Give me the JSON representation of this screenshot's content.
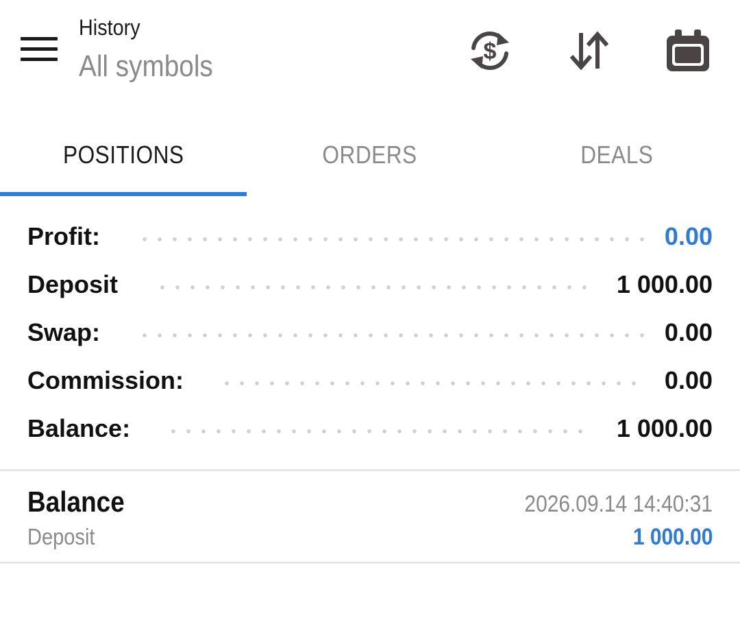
{
  "header": {
    "title": "History",
    "subtitle": "All symbols",
    "icons": [
      "menu-icon",
      "currency-exchange-icon",
      "sort-arrows-icon",
      "calendar-icon"
    ]
  },
  "tabs": [
    {
      "label": "POSITIONS",
      "active": true
    },
    {
      "label": "ORDERS",
      "active": false
    },
    {
      "label": "DEALS",
      "active": false
    }
  ],
  "summary": {
    "profit": {
      "label": "Profit:",
      "value": "0.00"
    },
    "deposit": {
      "label": "Deposit",
      "value": "1 000.00"
    },
    "swap": {
      "label": "Swap:",
      "value": "0.00"
    },
    "commission": {
      "label": "Commission:",
      "value": "0.00"
    },
    "balance": {
      "label": "Balance:",
      "value": "1 000.00"
    }
  },
  "entries": [
    {
      "title": "Balance",
      "type": "Deposit",
      "time": "2026.09.14 14:40:31",
      "amount": "1 000.00"
    }
  ],
  "colors": {
    "accent": "#2f7bd6",
    "muted": "#8a8a8a",
    "icon": "#4a4444"
  }
}
